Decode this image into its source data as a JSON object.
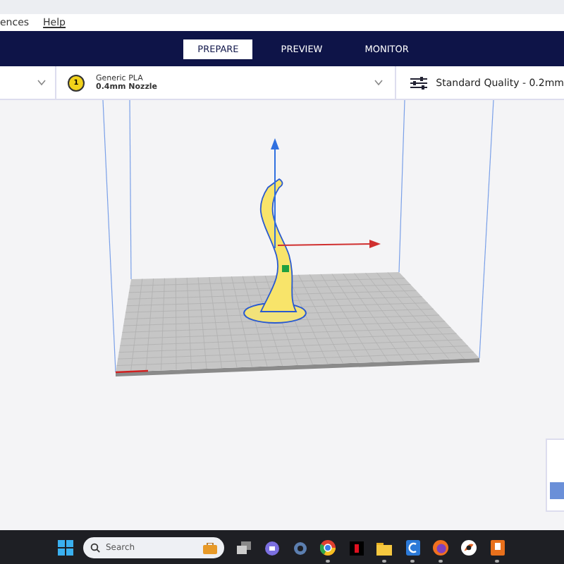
{
  "menu_bar": {
    "items": [
      "ences",
      "Help"
    ]
  },
  "stage_tabs": [
    {
      "label": "PREPARE",
      "selected": true
    },
    {
      "label": "PREVIEW",
      "selected": false
    },
    {
      "label": "MONITOR",
      "selected": false
    }
  ],
  "toolbar": {
    "extruder": {
      "number": "1",
      "material": "Generic PLA",
      "nozzle": "0.4mm Nozzle"
    },
    "quality": "Standard Quality - 0.2mm"
  },
  "taskbar": {
    "search_placeholder": "Search",
    "apps": [
      {
        "kind": "taskview",
        "running": false
      },
      {
        "kind": "chat",
        "running": false
      },
      {
        "kind": "settings",
        "running": false
      },
      {
        "kind": "browser",
        "running": true
      },
      {
        "kind": "tile",
        "running": false
      },
      {
        "kind": "folder",
        "running": true
      },
      {
        "kind": "slicer",
        "running": true
      },
      {
        "kind": "firefox",
        "running": true
      },
      {
        "kind": "app",
        "running": false
      },
      {
        "kind": "box",
        "running": true
      }
    ]
  }
}
